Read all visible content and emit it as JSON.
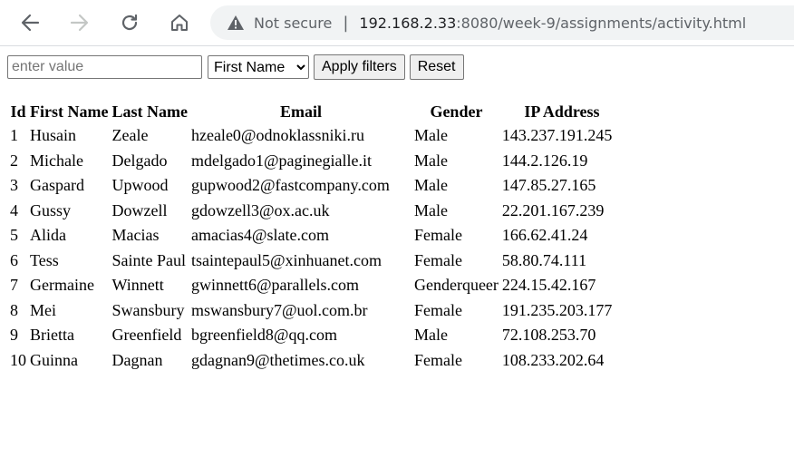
{
  "browser": {
    "security_label": "Not secure",
    "url_host": "192.168.2.33",
    "url_rest": ":8080/week-9/assignments/activity.html"
  },
  "filters": {
    "input_placeholder": "enter value",
    "input_value": "",
    "select_value": "First Name",
    "apply_label": "Apply filters",
    "reset_label": "Reset"
  },
  "table": {
    "headers": [
      "Id",
      "First Name",
      "Last Name",
      "Email",
      "Gender",
      "IP Address"
    ],
    "rows": [
      [
        "1",
        "Husain",
        "Zeale",
        "hzeale0@odnoklassniki.ru",
        "Male",
        "143.237.191.245"
      ],
      [
        "2",
        "Michale",
        "Delgado",
        "mdelgado1@paginegialle.it",
        "Male",
        "144.2.126.19"
      ],
      [
        "3",
        "Gaspard",
        "Upwood",
        "gupwood2@fastcompany.com",
        "Male",
        "147.85.27.165"
      ],
      [
        "4",
        "Gussy",
        "Dowzell",
        "gdowzell3@ox.ac.uk",
        "Male",
        "22.201.167.239"
      ],
      [
        "5",
        "Alida",
        "Macias",
        "amacias4@slate.com",
        "Female",
        "166.62.41.24"
      ],
      [
        "6",
        "Tess",
        "Sainte Paul",
        "tsaintepaul5@xinhuanet.com",
        "Female",
        "58.80.74.111"
      ],
      [
        "7",
        "Germaine",
        "Winnett",
        "gwinnett6@parallels.com",
        "Genderqueer",
        "224.15.42.167"
      ],
      [
        "8",
        "Mei",
        "Swansbury",
        "mswansbury7@uol.com.br",
        "Female",
        "191.235.203.177"
      ],
      [
        "9",
        "Brietta",
        "Greenfield",
        "bgreenfield8@qq.com",
        "Male",
        "72.108.253.70"
      ],
      [
        "10",
        "Guinna",
        "Dagnan",
        "gdagnan9@thetimes.co.uk",
        "Female",
        "108.233.202.64"
      ]
    ]
  }
}
